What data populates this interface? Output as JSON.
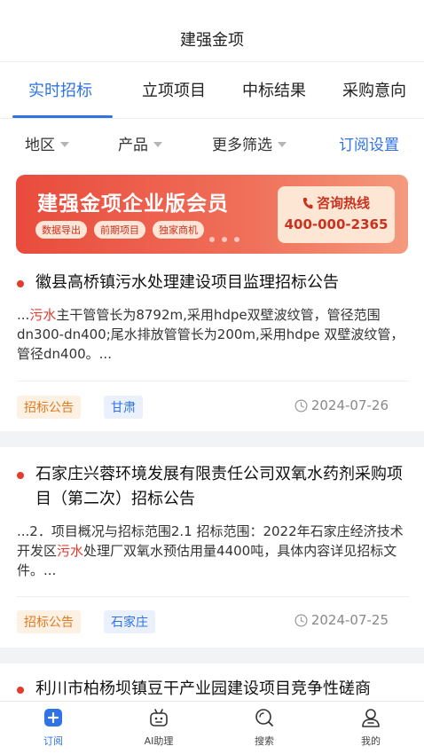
{
  "header": {
    "title": "建强金项"
  },
  "tabs": [
    {
      "label": "实时招标",
      "active": true
    },
    {
      "label": "立项项目"
    },
    {
      "label": "中标结果"
    },
    {
      "label": "采购意向"
    }
  ],
  "filters": {
    "region": "地区",
    "product": "产品",
    "more": "更多筛选",
    "subscribe": "订阅设置"
  },
  "banner": {
    "title": "建强金项企业版会员",
    "tags": [
      "数据导出",
      "前期项目",
      "独家商机"
    ],
    "hotline_label": "咨询热线",
    "hotline_number": "400-000-2365",
    "colors": {
      "accent": "#e94b3c"
    }
  },
  "items": [
    {
      "title": "徽县高桥镇污水处理建设项目监理招标公告",
      "desc_prefix": "...",
      "desc_highlight": "污水",
      "desc_rest": "主干管管长为8792m,采用hdpe双壁波纹管，管径范围dn300-dn400;尾水排放管管长为200m,采用hdpe 双壁波纹管，管径dn400。...",
      "type_tag": "招标公告",
      "region_tag": "甘肃",
      "date": "2024-07-26"
    },
    {
      "title": "石家庄兴蓉环境发展有限责任公司双氧水药剂采购项目（第二次）招标公告",
      "desc_prefix": "...2．项目概况与招标范围2.1 招标范围：2022年石家庄经济技术开发区",
      "desc_highlight": "污水",
      "desc_rest": "处理厂双氧水预估用量4400吨，具体内容详见招标文件。...",
      "type_tag": "招标公告",
      "region_tag": "石家庄",
      "date": "2024-07-25"
    },
    {
      "title": "利川市柏杨坝镇豆干产业园建设项目竞争性磋商"
    }
  ],
  "tabbar": [
    {
      "label": "订阅",
      "icon": "subscribe-icon",
      "active": true
    },
    {
      "label": "AI助理",
      "icon": "robot-icon"
    },
    {
      "label": "搜索",
      "icon": "search-icon"
    },
    {
      "label": "我的",
      "icon": "user-icon"
    }
  ]
}
